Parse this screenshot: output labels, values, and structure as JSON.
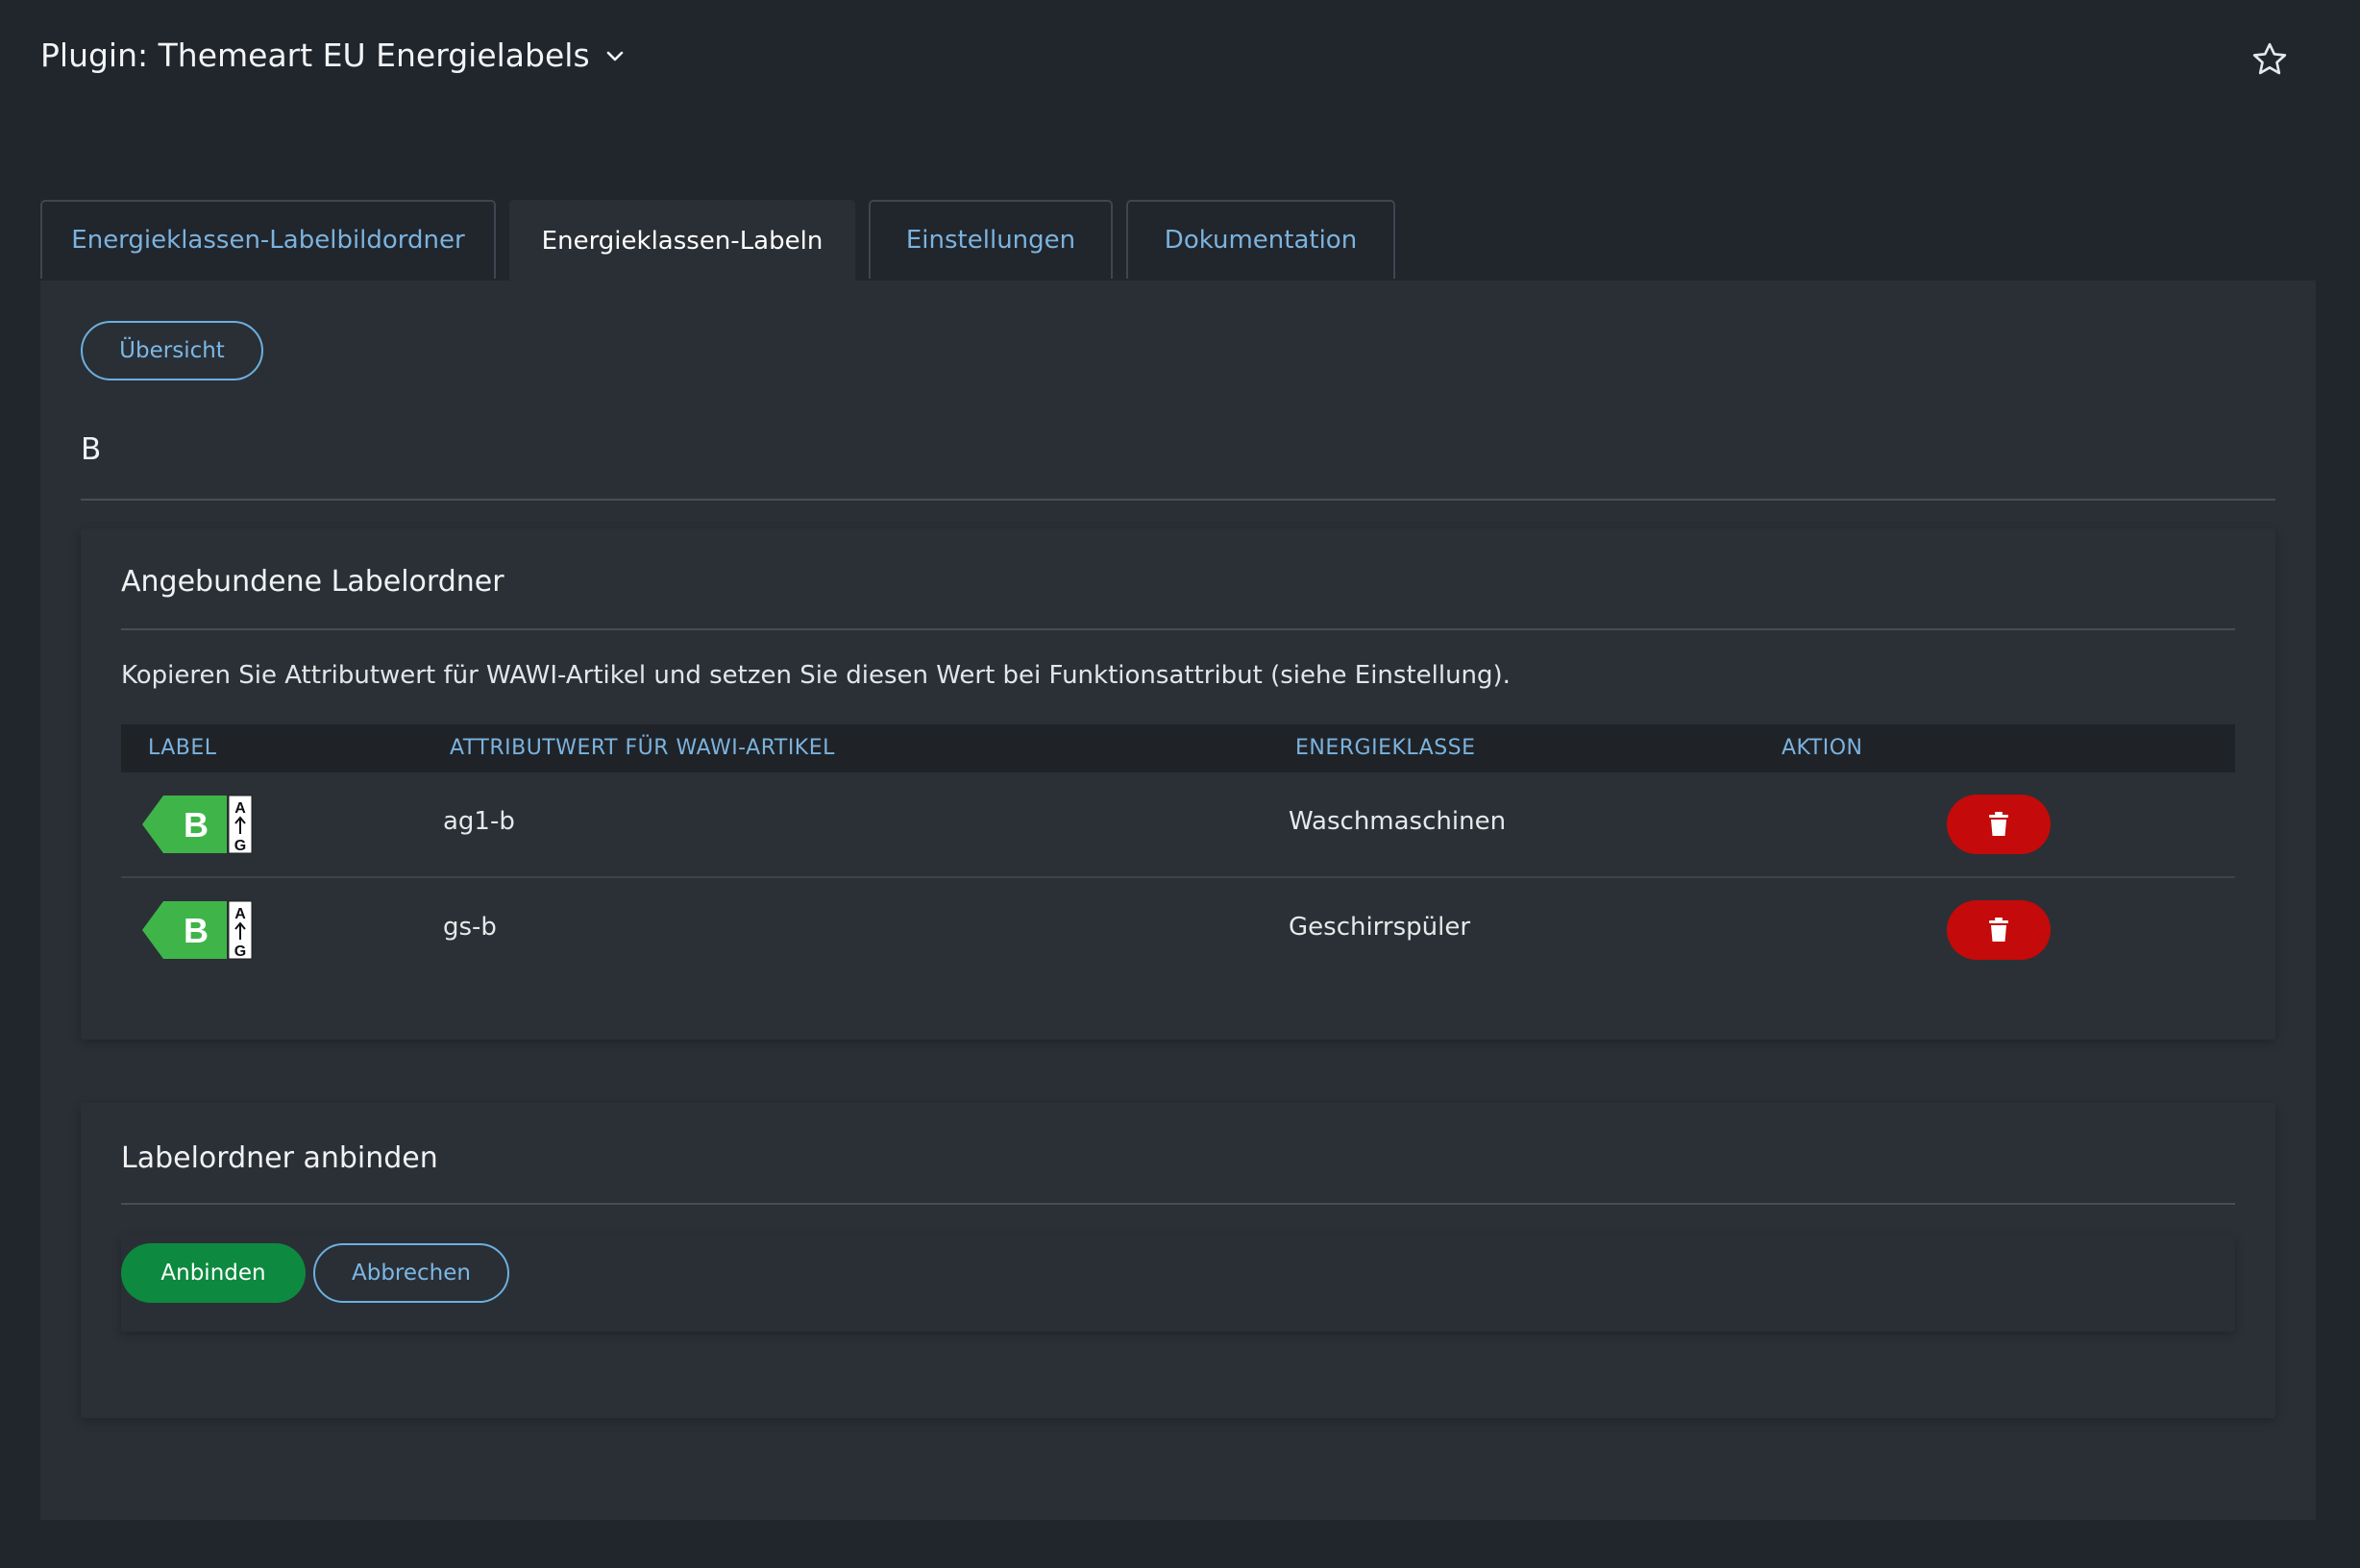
{
  "header": {
    "title": "Plugin: Themeart EU Energielabels"
  },
  "tabs": [
    {
      "label": "Energieklassen-Labelbildordner"
    },
    {
      "label": "Energieklassen-Labeln"
    },
    {
      "label": "Einstellungen"
    },
    {
      "label": "Dokumentation"
    }
  ],
  "active_tab": "Energieklassen-Labeln",
  "overview_button": "Übersicht",
  "section_heading": "B",
  "linked_card": {
    "title": "Angebundene Labelordner",
    "description": "Kopieren Sie Attributwert für WAWI-Artikel und setzen Sie diesen Wert bei Funktionsattribut (siehe Einstellung).",
    "columns": [
      "LABEL",
      "ATTRIBUTWERT FÜR WAWI-ARTIKEL",
      "ENERGIEKLASSE",
      "AKTION"
    ],
    "rows": [
      {
        "label_class": "B",
        "scale_top": "A",
        "scale_bottom": "G",
        "attribute": "ag1-b",
        "energy_class": "Waschmaschinen"
      },
      {
        "label_class": "B",
        "scale_top": "A",
        "scale_bottom": "G",
        "attribute": "gs-b",
        "energy_class": "Geschirrspüler"
      }
    ]
  },
  "bind_card": {
    "title": "Labelordner anbinden",
    "submit_label": "Anbinden",
    "cancel_label": "Abbrechen"
  },
  "colors": {
    "background": "#21252c",
    "panel": "#2a2f35",
    "accent_blue": "#7bb3de",
    "energy_green": "#3fb549",
    "danger_red": "#c40a0a",
    "success_green": "#0d8a3f"
  },
  "icons": {
    "title_dropdown": "chevron-down-icon",
    "favorite": "star-icon",
    "delete": "trash-icon"
  }
}
